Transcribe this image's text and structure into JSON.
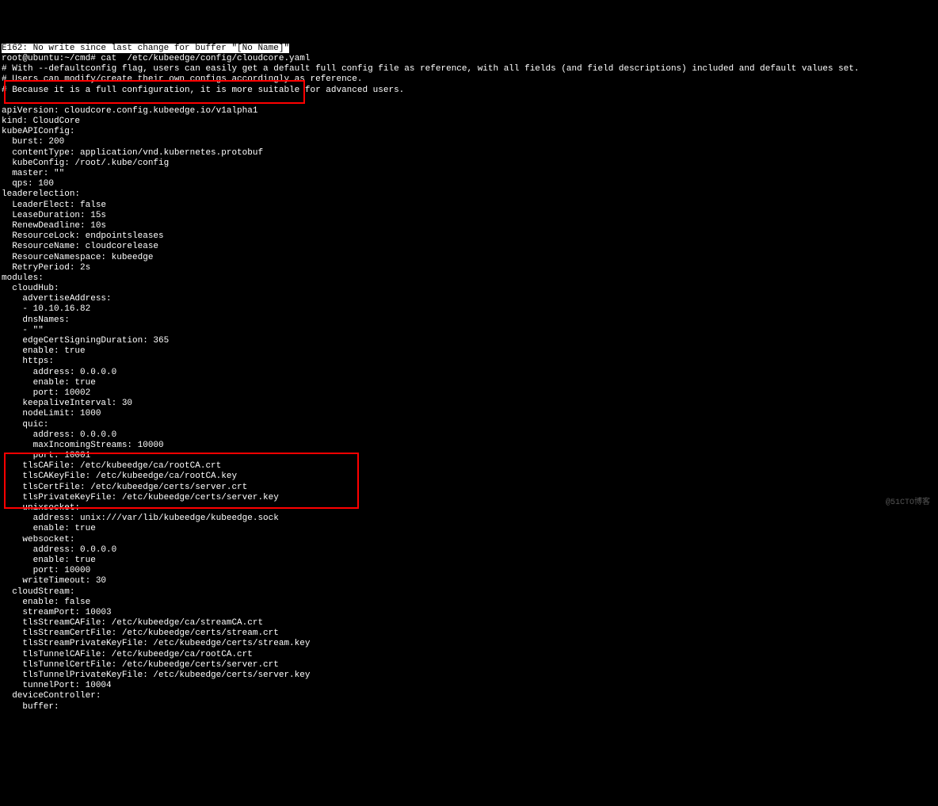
{
  "vim_error": "E162: No write since last change for buffer \"[No Name]\"",
  "prompt": "root@ubuntu:~/cmd# cat  /etc/kubeedge/config/cloudcore.yaml",
  "comment1": "# With --defaultconfig flag, users can easily get a default full config file as reference, with all fields (and field descriptions) included and default values set.",
  "comment2": "# Users can modify/create their own configs accordingly as reference.",
  "comment3": "# Because it is a full configuration, it is more suitable for advanced users.",
  "blank": "",
  "apiVersion": "apiVersion: cloudcore.config.kubeedge.io/v1alpha1",
  "kind": "kind: CloudCore",
  "kubeAPIConfig": "kubeAPIConfig:",
  "burst": "  burst: 200",
  "contentType": "  contentType: application/vnd.kubernetes.protobuf",
  "kubeConfig": "  kubeConfig: /root/.kube/config",
  "master": "  master: \"\"",
  "qps": "  qps: 100",
  "leaderelection": "leaderelection:",
  "LeaderElect": "  LeaderElect: false",
  "LeaseDuration": "  LeaseDuration: 15s",
  "RenewDeadline": "  RenewDeadline: 10s",
  "ResourceLock": "  ResourceLock: endpointsleases",
  "ResourceName": "  ResourceName: cloudcorelease",
  "ResourceNamespace": "  ResourceNamespace: kubeedge",
  "RetryPeriod": "  RetryPeriod: 2s",
  "modules": "modules:",
  "cloudHub": "  cloudHub:",
  "advertiseAddress": "    advertiseAddress:",
  "advAddr": "    - 10.10.16.82",
  "dnsNames": "    dnsNames:",
  "dnsVal": "    - \"\"",
  "edgeCertSigningDuration": "    edgeCertSigningDuration: 365",
  "enable1": "    enable: true",
  "https": "    https:",
  "address1": "      address: 0.0.0.0",
  "enable2": "      enable: true",
  "port1": "      port: 10002",
  "keepaliveInterval": "    keepaliveInterval: 30",
  "nodeLimit": "    nodeLimit: 1000",
  "quic": "    quic:",
  "address2": "      address: 0.0.0.0",
  "maxIncomingStreams": "      maxIncomingStreams: 10000",
  "port2": "      port: 10001",
  "tlsCAFile": "    tlsCAFile: /etc/kubeedge/ca/rootCA.crt",
  "tlsCAKeyFile": "    tlsCAKeyFile: /etc/kubeedge/ca/rootCA.key",
  "tlsCertFile": "    tlsCertFile: /etc/kubeedge/certs/server.crt",
  "tlsPrivateKeyFile": "    tlsPrivateKeyFile: /etc/kubeedge/certs/server.key",
  "unixsocket": "    unixsocket:",
  "address3": "      address: unix:///var/lib/kubeedge/kubeedge.sock",
  "enable3": "      enable: true",
  "websocket": "    websocket:",
  "address4": "      address: 0.0.0.0",
  "enable4": "      enable: true",
  "port3": "      port: 10000",
  "writeTimeout": "    writeTimeout: 30",
  "cloudStream": "  cloudStream:",
  "enable5": "    enable: false",
  "streamPort": "    streamPort: 10003",
  "tlsStreamCAFile": "    tlsStreamCAFile: /etc/kubeedge/ca/streamCA.crt",
  "tlsStreamCertFile": "    tlsStreamCertFile: /etc/kubeedge/certs/stream.crt",
  "tlsStreamPrivateKeyFile": "    tlsStreamPrivateKeyFile: /etc/kubeedge/certs/stream.key",
  "tlsTunnelCAFile": "    tlsTunnelCAFile: /etc/kubeedge/ca/rootCA.crt",
  "tlsTunnelCertFile": "    tlsTunnelCertFile: /etc/kubeedge/certs/server.crt",
  "tlsTunnelPrivateKeyFile": "    tlsTunnelPrivateKeyFile: /etc/kubeedge/certs/server.key",
  "tunnelPort": "    tunnelPort: 10004",
  "deviceController": "  deviceController:",
  "buffer": "    buffer:",
  "watermark": "@51CTO博客"
}
